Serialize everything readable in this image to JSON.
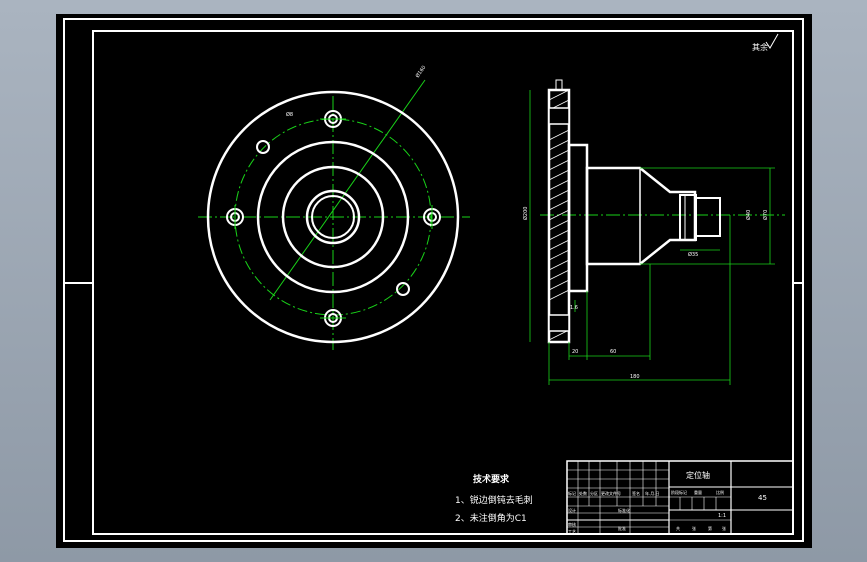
{
  "drawing": {
    "roughness_note": "其余",
    "notes_title": "技术要求",
    "notes": [
      "1、锐边倒钝去毛刺",
      "2、未注倒角为C1"
    ]
  },
  "dimensions": {
    "pcd": "Ø160",
    "bolt_circle": "Ø8",
    "overall_length": "180",
    "overall_diameter": "Ø200",
    "hub_diameter": "Ø70",
    "shaft_diameter": "Ø35",
    "bore_diameter": "Ø40",
    "flange_thickness": "20",
    "hub_length": "60",
    "chamfer": "1.6"
  },
  "title_block": {
    "part_name": "定位轴",
    "material": "45",
    "scale": "1:1",
    "row_labels": [
      "标记",
      "设计",
      "审核",
      "工艺"
    ],
    "header_cells": [
      "处数",
      "分区",
      "更改文件号",
      "签名",
      "年.月.日"
    ],
    "std_label": "标准化",
    "approve_label": "批准",
    "stage_labels": [
      "阶段标记",
      "重量",
      "比例"
    ],
    "sheet_labels": [
      "共",
      "张",
      "第",
      "张"
    ]
  }
}
